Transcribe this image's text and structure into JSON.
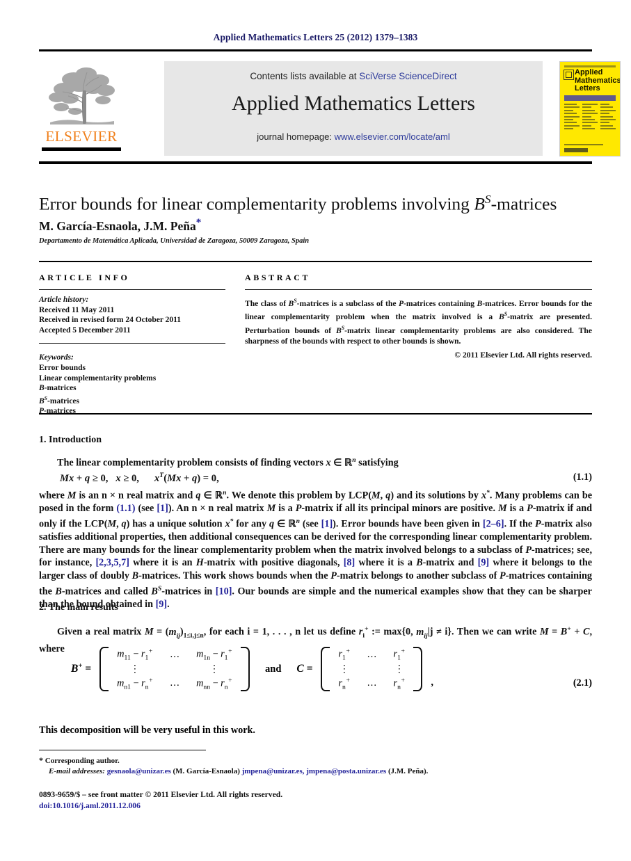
{
  "running_head": "Applied Mathematics Letters 25 (2012) 1379–1383",
  "masthead": {
    "contents_prefix": "Contents lists available at ",
    "contents_link": "SciVerse ScienceDirect",
    "journal_title": "Applied Mathematics Letters",
    "homepage_prefix": "journal homepage: ",
    "homepage_link": "www.elsevier.com/locate/aml",
    "publisher_logo_text": "ELSEVIER",
    "cover_title": "Applied Mathematics Letters",
    "accent_orange": "#F07F1A",
    "link_blue": "#2e3b9b",
    "cover_yellow": "#FFE800",
    "band_gray": "#e7e7e7"
  },
  "article": {
    "title_pre": "Error bounds for linear complementarity problems involving ",
    "title_math_base": "B",
    "title_math_sup": "S",
    "title_post": "-matrices",
    "authors": "M. García-Esnaola, J.M. Peña",
    "corresponding_marker": "*",
    "affiliation": "Departamento de Matemática Aplicada, Universidad de Zaragoza, 50009 Zaragoza, Spain"
  },
  "article_info": {
    "label": "ARTICLE INFO",
    "history_label": "Article history:",
    "history": [
      "Received 11 May 2011",
      "Received in revised form 24 October 2011",
      "Accepted 5 December 2011"
    ],
    "keywords_label": "Keywords:",
    "keywords": [
      "Error bounds",
      "Linear complementarity problems",
      "B-matrices",
      "BS-matrices",
      "P-matrices"
    ]
  },
  "abstract": {
    "label": "ABSTRACT",
    "text": "The class of BS-matrices is a subclass of the P-matrices containing B-matrices. Error bounds for the linear complementarity problem when the matrix involved is a BS-matrix are presented. Perturbation bounds of BS-matrix linear complementarity problems are also considered. The sharpness of the bounds with respect to other bounds is shown.",
    "copyright": "© 2011 Elsevier Ltd. All rights reserved."
  },
  "sections": {
    "intro_heading": "1. Introduction",
    "intro_lead": "The linear complementarity problem consists of finding vectors x ∈ ℝn satisfying",
    "equation_1_1": "Mx + q ≥ 0,   x ≥ 0,      xT (Mx + q) = 0,",
    "equation_1_1_number": "(1.1)",
    "intro_body": "where M is an n × n real matrix and q ∈ ℝn. We denote this problem by LCP(M, q) and its solutions by x*. Many problems can be posed in the form (1.1) (see [1]). An n × n real matrix M is a P-matrix if all its principal minors are positive. M is a P-matrix if and only if the LCP(M, q) has a unique solution x* for any q ∈ ℝn (see [1]). Error bounds have been given in [2–6]. If the P-matrix also satisfies additional properties, then additional consequences can be derived for the corresponding linear complementarity problem. There are many bounds for the linear complementarity problem when the matrix involved belongs to a subclass of P-matrices; see, for instance, [2,3,5,7] where it is an H-matrix with positive diagonals, [8] where it is a B-matrix and [9] where it belongs to the larger class of doubly B-matrices. This work shows bounds when the P-matrix belongs to another subclass of P-matrices containing the B-matrices and called BS-matrices in [10]. Our bounds are simple and the numerical examples show that they can be sharper than the bound obtained in [9].",
    "main_heading": "2. The main results",
    "main_lead": "Given a real matrix M = (mij)1≤i,j≤n, for each i = 1, . . . , n let us define ri+ := max{0, mij|j ≠ i}. Then we can write M = B+ + C, where",
    "equation_2_1_number": "(2.1)",
    "after_matrix": "This decomposition will be very useful in this work."
  },
  "matrix": {
    "left_label": "B+",
    "conjunction": "and",
    "right_label": "C",
    "left_rows": [
      [
        "m11 − r1+",
        "…",
        "m1n − r1+"
      ],
      [
        "⋮",
        "",
        "⋮"
      ],
      [
        "mn1 − rn+",
        "…",
        "mnn − rn+"
      ]
    ],
    "right_rows": [
      [
        "r1+",
        "…",
        "r1+"
      ],
      [
        "⋮",
        "",
        "⋮"
      ],
      [
        "rn+",
        "…",
        "rn+"
      ]
    ],
    "trailing_comma": ","
  },
  "footer": {
    "corresponding": "Corresponding author.",
    "email_label": "E-mail addresses:",
    "emails": [
      {
        "address": "gesnaola@unizar.es",
        "owner": "(M. García-Esnaola)"
      },
      {
        "address": "jmpena@unizar.es,",
        "owner": ""
      },
      {
        "address": "jmpena@posta.unizar.es",
        "owner": "(J.M. Peña)."
      }
    ],
    "issn_line": "0893-9659/$ – see front matter © 2011 Elsevier Ltd. All rights reserved.",
    "doi_line": "doi:10.1016/j.aml.2011.12.006"
  }
}
